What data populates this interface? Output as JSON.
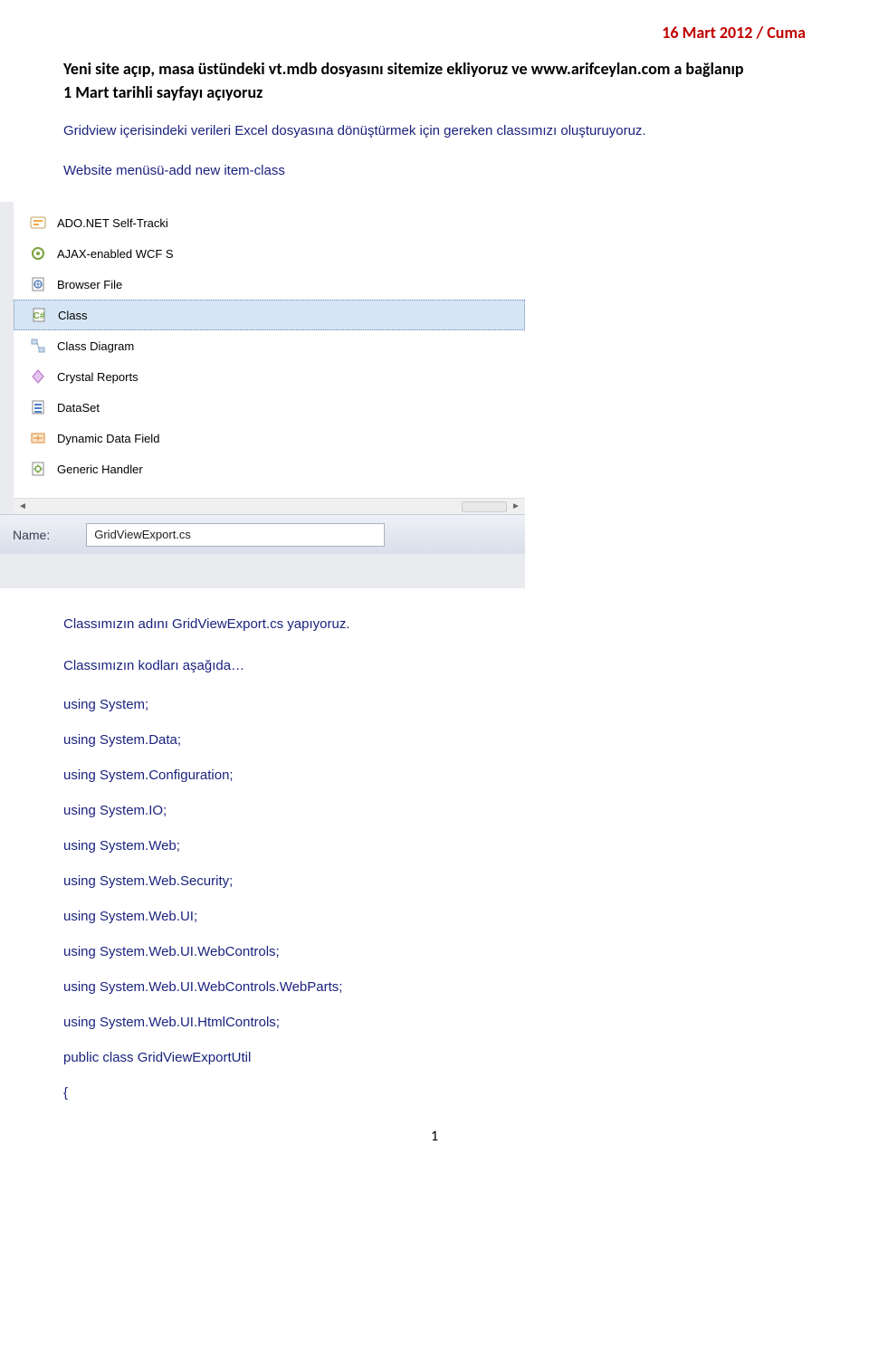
{
  "header_date": "16 Mart 2012 / Cuma",
  "intro": {
    "line1": "Yeni site açıp, masa üstündeki vt.mdb dosyasını sitemize ekliyoruz ve www.arifceylan.com a bağlanıp",
    "line2": "1 Mart tarihli sayfayı açıyoruz"
  },
  "para1": "Gridview içerisindeki verileri Excel dosyasına dönüştürmek için gereken classımızı oluşturuyoruz.",
  "para2": "Website menüsü-add new item-class",
  "dialog": {
    "items": [
      {
        "label": "ADO.NET Self-Tracki",
        "icon": "ado-icon",
        "color": "#f4a742"
      },
      {
        "label": "AJAX-enabled WCF S",
        "icon": "ajax-icon",
        "color": "#7aa33a"
      },
      {
        "label": "Browser File",
        "icon": "browser-file-icon",
        "color": "#5b86be"
      },
      {
        "label": "Class",
        "icon": "class-icon",
        "color": "#6ea23c",
        "selected": true
      },
      {
        "label": "Class Diagram",
        "icon": "class-diagram-icon",
        "color": "#8aa9c9"
      },
      {
        "label": "Crystal Reports",
        "icon": "crystal-reports-icon",
        "color": "#b56bc4"
      },
      {
        "label": "DataSet",
        "icon": "dataset-icon",
        "color": "#4b7fc9"
      },
      {
        "label": "Dynamic Data Field",
        "icon": "dynamic-data-icon",
        "color": "#d48a3a"
      },
      {
        "label": "Generic Handler",
        "icon": "generic-handler-icon",
        "color": "#6ea23c"
      }
    ],
    "name_label": "Name:",
    "name_value": "GridViewExport.cs"
  },
  "after_img_1": "Classımızın adını GridViewExport.cs yapıyoruz.",
  "after_img_2": "Classımızın kodları aşağıda…",
  "code_lines": [
    "using System;",
    "using System.Data;",
    "using System.Configuration;",
    "using System.IO;",
    "using System.Web;",
    "using System.Web.Security;",
    "using System.Web.UI;",
    "using System.Web.UI.WebControls;",
    "using System.Web.UI.WebControls.WebParts;",
    "using System.Web.UI.HtmlControls;",
    "public class GridViewExportUtil",
    "{"
  ],
  "page_num": "1"
}
